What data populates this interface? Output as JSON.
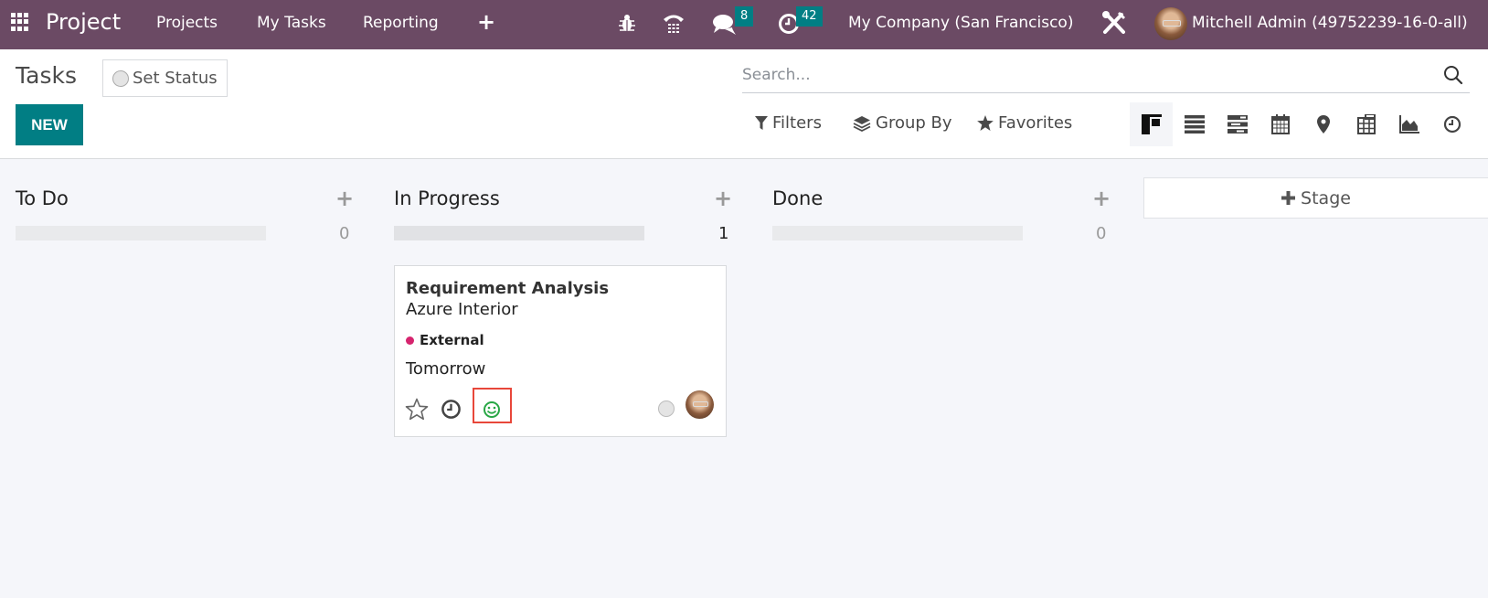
{
  "navbar": {
    "app_name": "Project",
    "menu": [
      "Projects",
      "My Tasks",
      "Reporting"
    ],
    "new_icon": "plus-icon",
    "systray": {
      "debug_icon": "bug-icon",
      "voip_icon": "phone-icon",
      "messages_icon": "chat-icon",
      "messages_count": "8",
      "activities_icon": "clock-icon",
      "activities_count": "42",
      "company": "My Company (San Francisco)",
      "settings_icon": "tools-icon",
      "user_name": "Mitchell Admin (49752239-16-0-all)"
    }
  },
  "control_panel": {
    "title": "Tasks",
    "set_status_label": "Set Status",
    "new_button": "NEW",
    "search_placeholder": "Search...",
    "filters_label": "Filters",
    "group_by_label": "Group By",
    "favorites_label": "Favorites",
    "views": [
      "kanban",
      "list",
      "gantt",
      "calendar",
      "map",
      "pivot",
      "graph",
      "activity"
    ],
    "active_view": "kanban"
  },
  "kanban": {
    "columns": [
      {
        "title": "To Do",
        "count": "0"
      },
      {
        "title": "In Progress",
        "count": "1"
      },
      {
        "title": "Done",
        "count": "0"
      }
    ],
    "add_stage_label": "Stage",
    "card": {
      "title": "Requirement Analysis",
      "partner": "Azure Interior",
      "tag": "External",
      "tag_color": "#d6246e",
      "deadline": "Tomorrow",
      "rating_icon": "smile-icon",
      "rating_color": "#28a745"
    }
  },
  "colors": {
    "navbar": "#6b4a64",
    "primary": "#017e84",
    "highlight": "#e8473a"
  }
}
